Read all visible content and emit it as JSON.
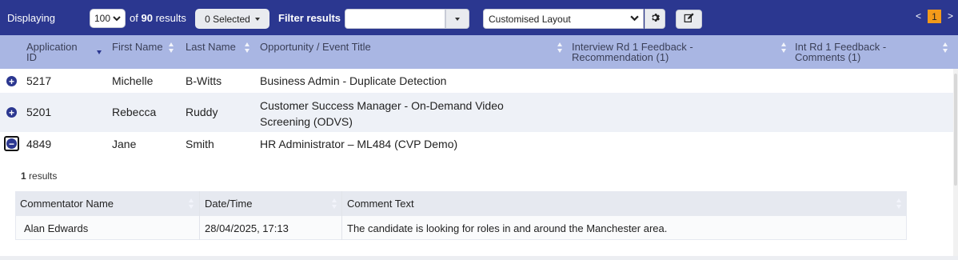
{
  "toolbar": {
    "displaying_label": "Displaying",
    "per_page": "100",
    "of_prefix": "of",
    "total": "90",
    "results_suffix": "results",
    "selected_label": "0 Selected",
    "filter_label": "Filter results",
    "filter_value": "",
    "layout_value": "Customised Layout",
    "pager_prev": "<",
    "pager_page": "1",
    "pager_next": ">"
  },
  "columns": {
    "app_id_line1": "Application",
    "app_id_line2": "ID",
    "first_name": "First Name",
    "last_name": "Last Name",
    "opportunity": "Opportunity / Event Title",
    "interview_line1": "Interview Rd 1 Feedback -",
    "interview_line2": "Recommendation (1)",
    "int_comments_line1": "Int Rd 1 Feedback -",
    "int_comments_line2": "Comments (1)"
  },
  "rows": [
    {
      "id": "5217",
      "first": "Michelle",
      "last": "B-Witts",
      "title_line1": "Business Admin - Duplicate Detection",
      "title_line2": ""
    },
    {
      "id": "5201",
      "first": "Rebecca",
      "last": "Ruddy",
      "title_line1": "Customer Success Manager - On-Demand Video",
      "title_line2": "Screening (ODVS)"
    },
    {
      "id": "4849",
      "first": "Jane",
      "last": "Smith",
      "title_line1": "HR Administrator – ML484 (CVP Demo)",
      "title_line2": ""
    }
  ],
  "detail": {
    "count": "1",
    "results_label": "results",
    "headers": {
      "commentator": "Commentator Name",
      "datetime": "Date/Time",
      "comment": "Comment Text"
    },
    "row": {
      "commentator": "Alan Edwards",
      "datetime": "28/04/2025, 17:13",
      "comment": "The candidate is looking for roles in and around the Manchester area."
    }
  },
  "colors": {
    "toolbar_bg": "#2b3790",
    "header_bg": "#a9b6e3",
    "accent_page": "#f39a1a"
  }
}
